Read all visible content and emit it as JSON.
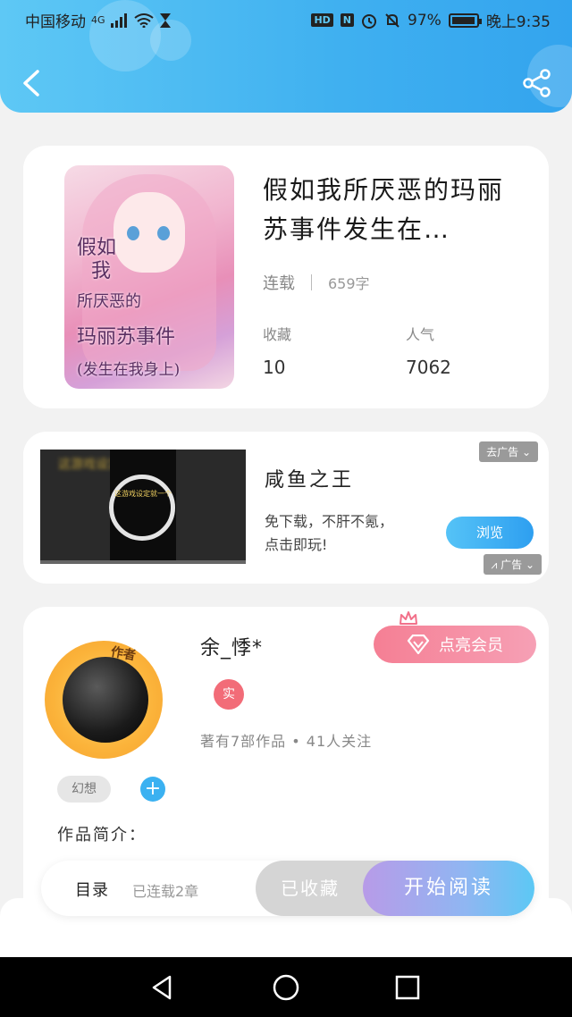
{
  "status_bar": {
    "carrier": "中国移动",
    "network": "4G",
    "hd": "HD",
    "nfc": "N",
    "battery": "97%",
    "battery_level": 0.97,
    "time": "晚上9:35"
  },
  "book": {
    "title": "假如我所厌恶的玛丽苏事件发生在…",
    "cover_lines": [
      "假如",
      "我",
      "所厌恶的",
      "玛丽苏事件",
      "(发生在我身上)"
    ],
    "status": "连载",
    "word_count": "659字",
    "favorites_label": "收藏",
    "favorites_value": "10",
    "popularity_label": "人气",
    "popularity_value": "7062"
  },
  "ad": {
    "remove_label": "去广告",
    "title": "咸鱼之王",
    "description": "免下载，不肝不氪，点击即玩!",
    "browse_label": "浏览",
    "ad_label": "广告",
    "video_caption": "这游戏设定就一个",
    "video_blur_text": "这游戏设定就一个字"
  },
  "author": {
    "name": "余_悸*",
    "badge_text": "作者",
    "vip_label": "点亮会员",
    "real_badge": "实",
    "stats": "著有7部作品 • 41人关注",
    "tag": "幻想",
    "add_tag": "+",
    "intro_label": "作品简介："
  },
  "action_bar": {
    "catalog_label": "目录",
    "chapters_label": "已连载2章",
    "collected_label": "已收藏",
    "start_reading_label": "开始阅读"
  },
  "colors": {
    "header_blue": "#3fb0f0",
    "accent_pink": "#f57f94",
    "accent_blue": "#3bb1f1",
    "gradient_purple": "#b89be8"
  }
}
